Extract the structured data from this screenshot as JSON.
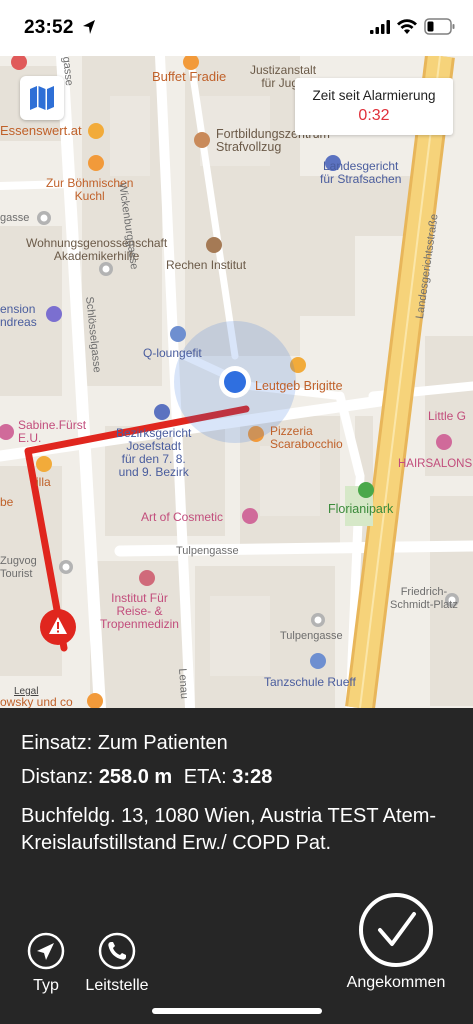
{
  "status_bar": {
    "time": "23:52",
    "icons": [
      "location-arrow-icon",
      "cellular-signal-icon",
      "wifi-icon",
      "battery-icon"
    ]
  },
  "map": {
    "timer_label": "Zeit seit Alarmierung",
    "timer_value": "0:32",
    "legal": "Legal",
    "labels": {
      "buffet": "Buffet Fradie",
      "justiz": "Justizanstalt\nfür Juge",
      "essenswert": "Essenswert.at",
      "fortbildung": "Fortbildungszentrum\nStrafvollzug",
      "landesgericht_straf": "Landesgericht\nfür Strafsachen",
      "boehmischen": "Zur Böhmischen\nKuchl",
      "gasse_left": "gasse",
      "wohnung": "Wohnungsgenossenschaft\nAkademikerhilfe",
      "rechen": "Rechen Institut",
      "pension": "ension\nndreas",
      "qloungefit": "Q-loungefit",
      "leutgeb": "Leutgeb Brigitte",
      "bezirksgericht": "Bezirksgericht\nJosefstadt\nfür den 7. 8.\nund 9. Bezirk",
      "pizzeria": "Pizzeria\nScarabocchio",
      "little": "Little G",
      "hairsalons": "HAIRSALONS",
      "sabine": "Sabine.Fürst\nE.U.",
      "billa": "illa",
      "be": "be",
      "art": "Art of Cosmetic",
      "florianipark": "Florianipark",
      "zugvog": "Zugvog\nTourist",
      "tulpengasse_1": "Tulpengasse",
      "institut": "Institut Für\nReise- &\nTropenmedizin",
      "friedrich": "Friedrich-\nSchmidt-Platz",
      "tulpengasse_2": "Tulpengasse",
      "tanzschule": "Tanzschule Rueff",
      "nowsky": "owsky und co",
      "wickenburggasse": "Wickenburggasse",
      "schloessel": "Schlösselgasse",
      "landesgerichtsstrasse": "Landesgerichtsstraße",
      "lenau": "Lenau",
      "gasse_top": "gasse"
    }
  },
  "panel": {
    "einsatz": "Einsatz: Zum Patienten",
    "distanz_label": "Distanz:",
    "distanz_value": "258.0 m",
    "eta_label": "ETA:",
    "eta_value": "3:28",
    "address": "Buchfeldg. 13, 1080 Wien, Austria TEST Atem-Kreislaufstillstand Erw./ COPD Pat.",
    "btn_typ": "Typ",
    "btn_leitstelle": "Leitstelle",
    "btn_angekommen": "Angekommen"
  },
  "colors": {
    "route": "#e0261e",
    "location": "#2f6fe0",
    "timer": "#e0303a",
    "panel": "#262626",
    "major_road": "#f6d37a"
  }
}
